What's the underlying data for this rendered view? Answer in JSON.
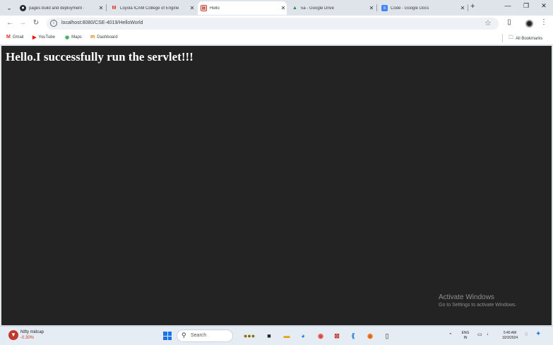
{
  "browser": {
    "tabs": [
      {
        "label": "pages build and deployment ·",
        "favicon": "github-icon",
        "active": false
      },
      {
        "label": "Loyola ICAM College of Engine",
        "favicon": "gmail-icon",
        "active": false
      },
      {
        "label": "Hello",
        "favicon": "page-icon",
        "active": true
      },
      {
        "label": "5a - Google Drive",
        "favicon": "google-drive-icon",
        "active": false
      },
      {
        "label": "Code - Google Docs",
        "favicon": "google-docs-icon",
        "active": false
      }
    ],
    "url": "localhost:8080/CSE-4019/HelloWorld",
    "bookmarks": [
      {
        "label": "Gmail",
        "icon": "gmail-icon"
      },
      {
        "label": "YouTube",
        "icon": "youtube-icon"
      },
      {
        "label": "Maps",
        "icon": "maps-icon"
      },
      {
        "label": "Dashboard",
        "icon": "dashboard-icon"
      }
    ],
    "all_bookmarks_label": "All Bookmarks"
  },
  "page": {
    "heading": "Hello.I successfully run the servlet!!!",
    "background_color": "#232323",
    "text_color": "#ffffff"
  },
  "watermark": {
    "title": "Activate Windows",
    "subtitle": "Go to Settings to activate Windows."
  },
  "taskbar": {
    "weather_label": "Nifty midcap",
    "weather_value": "-0.30%",
    "search_placeholder": "Search",
    "language": "ENG",
    "region": "IN",
    "time": "5:40 AM",
    "date": "10/3/2024"
  }
}
